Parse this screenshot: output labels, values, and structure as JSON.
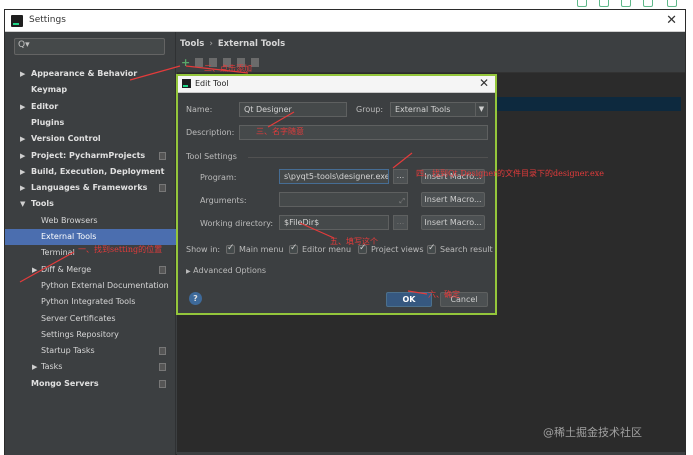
{
  "window": {
    "title": "Settings",
    "close_glyph": "✕"
  },
  "sidebar": {
    "search_placeholder": "Q▾",
    "items": [
      {
        "label": "Appearance & Behavior",
        "bold": true,
        "expand": "collapsed"
      },
      {
        "label": "Keymap",
        "bold": true,
        "expand": "none"
      },
      {
        "label": "Editor",
        "bold": true,
        "expand": "collapsed"
      },
      {
        "label": "Plugins",
        "bold": true,
        "expand": "none"
      },
      {
        "label": "Version Control",
        "bold": true,
        "expand": "collapsed"
      },
      {
        "label": "Project: PycharmProjects",
        "bold": true,
        "expand": "collapsed"
      },
      {
        "label": "Build, Execution, Deployment",
        "bold": true,
        "expand": "collapsed"
      },
      {
        "label": "Languages & Frameworks",
        "bold": true,
        "expand": "collapsed"
      },
      {
        "label": "Tools",
        "bold": true,
        "expand": "expanded"
      },
      {
        "label": "Web Browsers",
        "bold": false,
        "expand": "none"
      },
      {
        "label": "External Tools",
        "bold": false,
        "expand": "none",
        "selected": true
      },
      {
        "label": "Terminal",
        "bold": false,
        "expand": "none"
      },
      {
        "label": "Diff & Merge",
        "bold": false,
        "expand": "collapsed"
      },
      {
        "label": "Python External Documentation",
        "bold": false,
        "expand": "none"
      },
      {
        "label": "Python Integrated Tools",
        "bold": false,
        "expand": "none"
      },
      {
        "label": "Server Certificates",
        "bold": false,
        "expand": "none"
      },
      {
        "label": "Settings Repository",
        "bold": false,
        "expand": "none"
      },
      {
        "label": "Startup Tasks",
        "bold": false,
        "expand": "none"
      },
      {
        "label": "Tasks",
        "bold": false,
        "expand": "collapsed"
      },
      {
        "label": "Mongo Servers",
        "bold": true,
        "expand": "none"
      }
    ]
  },
  "main": {
    "breadcrumb": [
      "Tools",
      "External Tools"
    ],
    "breadcrumb_sep": "›",
    "add_glyph": "+"
  },
  "dialog": {
    "title": "Edit Tool",
    "close_glyph": "✕",
    "name_label": "Name:",
    "name_value": "Qt Designer",
    "group_label": "Group:",
    "group_value": "External Tools",
    "description_label": "Description:",
    "description_value": "",
    "tool_settings_label": "Tool Settings",
    "program_label": "Program:",
    "program_value": "s\\pyqt5-tools\\designer.exe",
    "arguments_label": "Arguments:",
    "arguments_value": "",
    "workdir_label": "Working directory:",
    "workdir_value": "$FileDir$",
    "browse_glyph": "...",
    "insert_macro_label": "Insert Macro...",
    "show_in_label": "Show in:",
    "show_in_options": [
      "Main menu",
      "Editor menu",
      "Project views",
      "Search result"
    ],
    "advanced_label": "Advanced Options",
    "help_glyph": "?",
    "ok_label": "OK",
    "cancel_label": "Cancel"
  },
  "annotations": {
    "a1": "二、点击添加",
    "a2": "三、名字随意",
    "a3": "四、找到Qt Designer的文件目录下的designer.exe",
    "a4": "五、填写这个",
    "a5": "一、找到setting的位置",
    "a6": "六、确定",
    "color": "#e33b3b"
  },
  "watermark": "@稀土掘金技术社区",
  "colors": {
    "accent": "#4b6eaf",
    "dialog_border": "#94c63b",
    "ok_button": "#365880"
  }
}
